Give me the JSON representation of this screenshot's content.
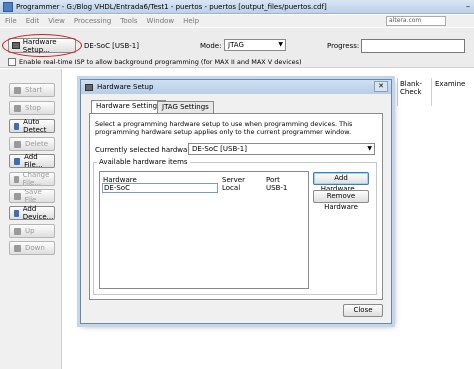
{
  "window": {
    "title": "Programmer - G:/Blog VHDL/Entrada6/Test1 - puertos - puertos [output_files/puertos.cdf]",
    "minimize_glyph": "–"
  },
  "menu": {
    "items": [
      "File",
      "Edit",
      "View",
      "Processing",
      "Tools",
      "Window",
      "Help"
    ],
    "search_text": "altera.com"
  },
  "toolbar": {
    "hardware_setup_label": "Hardware Setup...",
    "hardware_value": "DE-SoC [USB-1]",
    "mode_label": "Mode:",
    "mode_value": "JTAG",
    "progress_label": "Progress:",
    "isp_label": "Enable real-time ISP to allow background programming (for MAX II and MAX V devices)",
    "highlight_color": "#d21a1a"
  },
  "sidebar": {
    "buttons": [
      {
        "label": "Start",
        "icon": "play-icon",
        "enabled": false
      },
      {
        "label": "Stop",
        "icon": "stop-icon",
        "enabled": false
      },
      {
        "label": "Auto Detect",
        "icon": "auto-detect-icon",
        "enabled": true
      },
      {
        "label": "Delete",
        "icon": "delete-icon",
        "enabled": false
      },
      {
        "label": "Add File...",
        "icon": "add-file-icon",
        "enabled": true
      },
      {
        "label": "Change File...",
        "icon": "change-file-icon",
        "enabled": false
      },
      {
        "label": "Save File",
        "icon": "save-icon",
        "enabled": false
      },
      {
        "label": "Add Device...",
        "icon": "add-device-icon",
        "enabled": true
      },
      {
        "label": "Up",
        "icon": "up-arrow-icon",
        "enabled": false
      },
      {
        "label": "Down",
        "icon": "down-arrow-icon",
        "enabled": false
      }
    ]
  },
  "table": {
    "columns": [
      {
        "label": "Blank-\nCheck"
      },
      {
        "label": "Examine"
      }
    ]
  },
  "dialog": {
    "title": "Hardware Setup",
    "close_glyph": "✕",
    "tabs": [
      {
        "label": "Hardware Settings"
      },
      {
        "label": "JTAG Settings"
      }
    ],
    "description": "Select a programming hardware setup to use when programming devices. This programming hardware setup applies only to the current programmer window.",
    "current_label": "Currently selected hardware:",
    "current_value": "DE-SoC [USB-1]",
    "available_label": "Available hardware items",
    "list": {
      "headers": [
        "Hardware",
        "Server",
        "Port"
      ],
      "rows": [
        {
          "hardware": "DE-SoC",
          "server": "Local",
          "port": "USB-1"
        }
      ]
    },
    "add_hardware_label": "Add Hardware...",
    "remove_hardware_label": "Remove Hardware",
    "close_label": "Close"
  }
}
